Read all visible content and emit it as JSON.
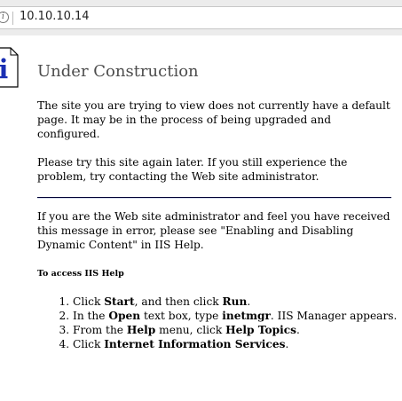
{
  "browser": {
    "url": "10.10.10.14"
  },
  "page": {
    "title": "Under Construction",
    "intro": "The site you are trying to view does not currently have a default page. It may be in the process of being upgraded and configured.",
    "retry": "Please try this site again later. If you still experience the problem, try contacting the Web site administrator.",
    "admin_note": "If you are the Web site administrator and feel you have received this message in error, please see \"Enabling and Disabling Dynamic Content\" in IIS Help.",
    "help_heading": "To access IIS Help",
    "steps": [
      {
        "pre": "Click ",
        "b1": "Start",
        "mid": ", and then click ",
        "b2": "Run",
        "post": "."
      },
      {
        "pre": "In the ",
        "b1": "Open",
        "mid": " text box, type ",
        "b2": "inetmgr",
        "post": ". IIS Manager appears."
      },
      {
        "pre": "From the ",
        "b1": "Help",
        "mid": " menu, click ",
        "b2": "Help Topics",
        "post": "."
      },
      {
        "pre": "Click ",
        "b1": "Internet Information Services",
        "mid": "",
        "b2": "",
        "post": "."
      }
    ]
  },
  "colors": {
    "title": "#4d4d4d",
    "icon_blue": "#1a2fb3"
  }
}
